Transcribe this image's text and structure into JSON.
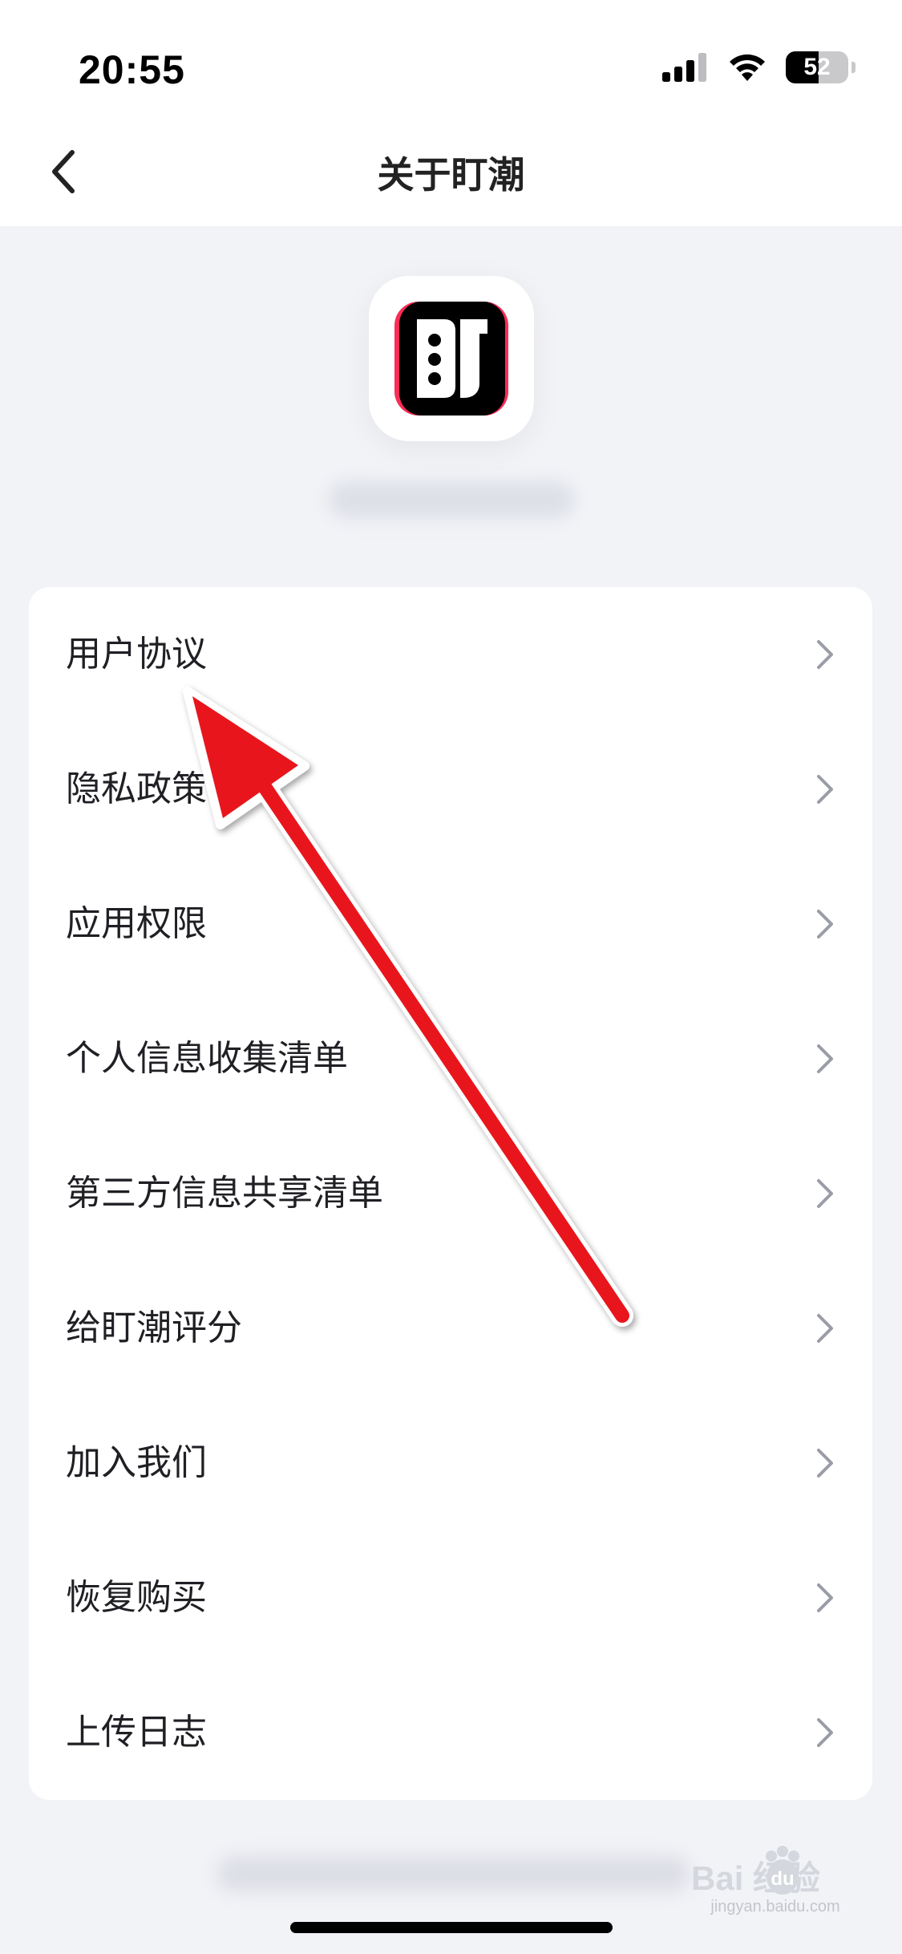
{
  "status_bar": {
    "time": "20:55",
    "battery_level": "52",
    "battery_fraction": 0.52,
    "icons": [
      "signal-icon",
      "wifi-icon",
      "battery-icon"
    ]
  },
  "nav": {
    "title": "关于盯潮",
    "back_icon": "chevron-left-icon"
  },
  "app": {
    "icon": "app-logo-icon",
    "brand_colors": {
      "cyan": "#25f4ee",
      "red": "#fe2c55",
      "black": "#000000"
    }
  },
  "menu": {
    "items": [
      {
        "label": "用户协议"
      },
      {
        "label": "隐私政策"
      },
      {
        "label": "应用权限"
      },
      {
        "label": "个人信息收集清单"
      },
      {
        "label": "第三方信息共享清单"
      },
      {
        "label": "给盯潮评分"
      },
      {
        "label": "加入我们"
      },
      {
        "label": "恢复购买"
      },
      {
        "label": "上传日志"
      }
    ],
    "chevron_icon": "chevron-right-icon",
    "chevron_color": "#9a9ca6"
  },
  "annotation": {
    "color": "#e8121f"
  },
  "watermark": {
    "text": "jingyan.baidu.com",
    "logo_text": "Bai 经验",
    "logo_mid": "du"
  }
}
